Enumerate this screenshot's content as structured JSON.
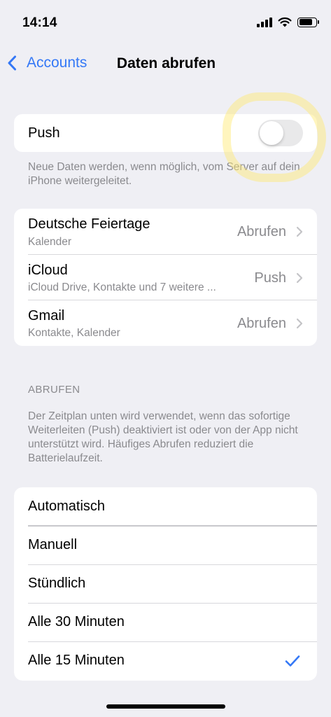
{
  "status_bar": {
    "time": "14:14"
  },
  "nav": {
    "back_label": "Accounts",
    "title": "Daten abrufen"
  },
  "push": {
    "label": "Push",
    "enabled": false,
    "footnote": "Neue Daten werden, wenn möglich, vom Server auf dein iPhone weitergeleitet."
  },
  "accounts": [
    {
      "name": "Deutsche Feiertage",
      "detail": "Kalender",
      "value": "Abrufen"
    },
    {
      "name": "iCloud",
      "detail": "iCloud Drive, Kontakte und 7 weitere ...",
      "value": "Push"
    },
    {
      "name": "Gmail",
      "detail": "Kontakte, Kalender",
      "value": "Abrufen"
    }
  ],
  "fetch": {
    "header": "ABRUFEN",
    "footnote": "Der Zeitplan unten wird verwendet, wenn das sofortige Weiterleiten (Push) deaktiviert ist oder von der App nicht unterstützt wird. Häufiges Abrufen reduziert die Batterielaufzeit.",
    "options": [
      "Automatisch",
      "Manuell",
      "Stündlich",
      "Alle 30 Minuten",
      "Alle 15 Minuten"
    ],
    "selected": "Alle 15 Minuten"
  },
  "colors": {
    "accent": "#3478f6",
    "background": "#efeff4",
    "secondary_text": "#8a8a8e",
    "highlighter": "#ffe86e"
  },
  "icons": [
    "signal-icon",
    "wifi-icon",
    "battery-icon",
    "chevron-left-icon",
    "chevron-right-icon",
    "checkmark-icon"
  ]
}
